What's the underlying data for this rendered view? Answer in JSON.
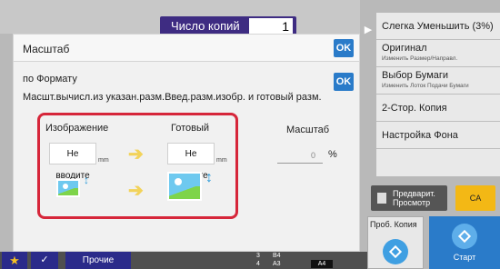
{
  "header": {
    "copies_label": "Число копий",
    "copies_value": "1"
  },
  "right_panel": {
    "items": [
      {
        "title": "Слегка Уменьшить (3%)",
        "subtitle": ""
      },
      {
        "title": "Оригинал",
        "subtitle": "Изменить Размер/Направл."
      },
      {
        "title": "Выбор Бумаги",
        "subtitle": "Изменить Лоток Подачи Бумаги"
      },
      {
        "title": "2-Стор. Копия",
        "subtitle": ""
      },
      {
        "title": "Настройка Фона",
        "subtitle": ""
      }
    ]
  },
  "dialog": {
    "title": "Масштаб",
    "ok_label": "OK",
    "subtitle": "по Формату",
    "description": "Масшт.вычисл.из указан.разм.Введ.разм.изобр. и готовый разм.",
    "image_label": "Изображение",
    "finished_label": "Готовый",
    "input_placeholder": "Не вводите",
    "unit_mm": "mm",
    "scale_label": "Масштаб",
    "scale_value": "0",
    "scale_unit": "%"
  },
  "actions": {
    "preview_label": "Предварит. Просмотр",
    "ca_label": "CA",
    "proof_label": "Проб. Копия",
    "start_label": "Старт"
  },
  "bottombar": {
    "other_label": "Прочие",
    "paper": [
      {
        "num": "3",
        "size": "B4"
      },
      {
        "num": "4",
        "size": "A3"
      }
    ],
    "selected_paper": "A4"
  },
  "colors": {
    "accent": "#2a7bc9",
    "highlight": "#d6263a",
    "ca": "#f3b815",
    "nav": "#2b2b8a"
  }
}
